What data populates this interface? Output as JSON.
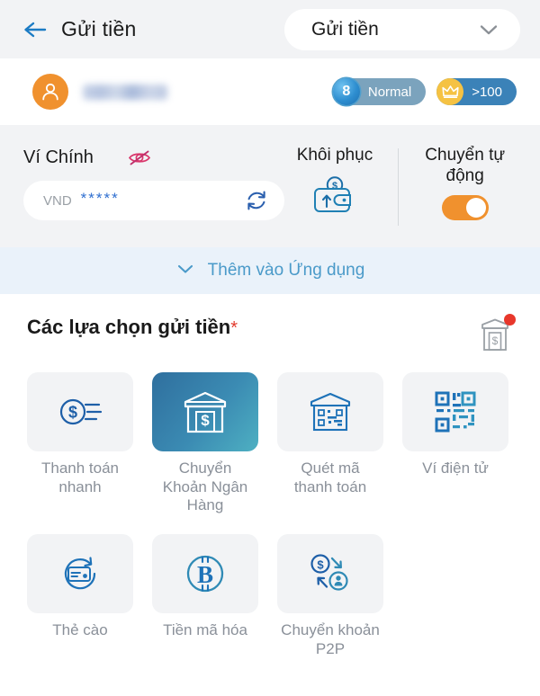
{
  "header": {
    "back_icon": "arrow-left-icon",
    "title": "Gửi tiền",
    "select_value": "Gửi tiền",
    "chevron_icon": "chevron-down-icon"
  },
  "user": {
    "avatar_icon": "user-avatar-icon",
    "name": "",
    "name_redacted": true,
    "badges": [
      {
        "icon": "level-medal-icon",
        "level": "8",
        "label": "Normal"
      },
      {
        "icon": "crown-icon",
        "label": ">100"
      }
    ]
  },
  "wallet": {
    "label": "Ví Chính",
    "eye_icon": "eye-off-icon",
    "currency": "VND",
    "balance_masked": "*****",
    "refresh_icon": "refresh-icon",
    "restore": {
      "title": "Khôi phục",
      "icon": "wallet-up-icon"
    },
    "auto_transfer": {
      "title": "Chuyển tự động",
      "toggle_on": true
    }
  },
  "banner": {
    "chevron_icon": "chevron-down-icon",
    "text": "Thêm vào Ứng dụng"
  },
  "options": {
    "title": "Các lựa chọn gửi tiền",
    "required_mark": "*",
    "store_icon": "storefront-icon",
    "has_notification": true,
    "items": [
      {
        "icon": "fast-payment-icon",
        "label": "Thanh toán\nnhanh",
        "selected": false
      },
      {
        "icon": "bank-transfer-icon",
        "label": "Chuyển\nKhoản Ngân\nHàng",
        "selected": true
      },
      {
        "icon": "qr-store-icon",
        "label": "Quét mã\nthanh toán",
        "selected": false
      },
      {
        "icon": "qr-code-icon",
        "label": "Ví điện tử",
        "selected": false
      },
      {
        "icon": "scratch-card-icon",
        "label": "Thẻ cào",
        "selected": false
      },
      {
        "icon": "bitcoin-icon",
        "label": "Tiền mã hóa",
        "selected": false
      },
      {
        "icon": "p2p-transfer-icon",
        "label": "Chuyển khoản\nP2P",
        "selected": false
      }
    ]
  },
  "colors": {
    "accent_blue": "#2f6fd0",
    "brand_orange": "#f0912e",
    "teal": "#4a9ac9",
    "alert_red": "#e8372b",
    "gold": "#f5c243"
  }
}
